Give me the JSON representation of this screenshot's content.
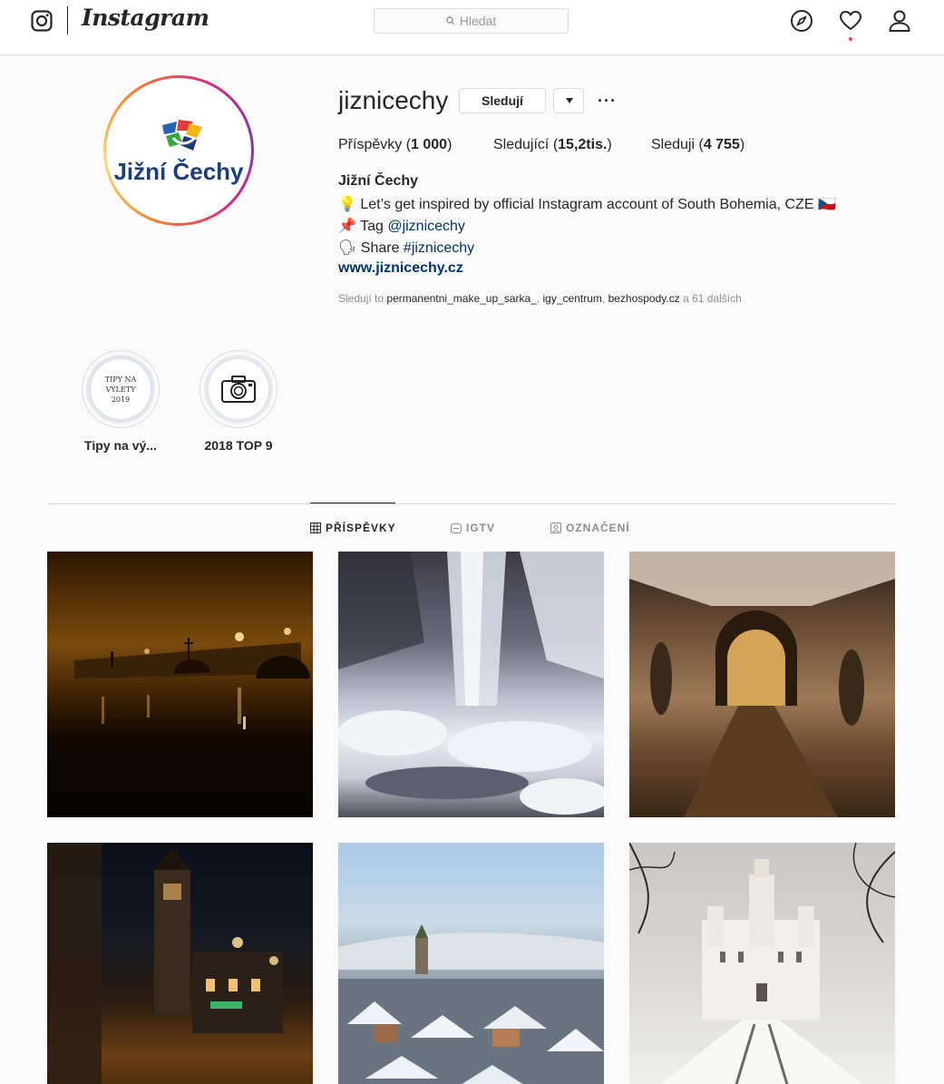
{
  "nav": {
    "wordmark": "Instagram",
    "search_placeholder": "Hledat",
    "icons": [
      "instagram-icon",
      "search-icon",
      "compass-icon",
      "heart-icon",
      "user-icon"
    ],
    "notification_color": "#ed4956"
  },
  "profile": {
    "avatar_text": "Jižní Čechy",
    "username": "jiznicechy",
    "follow_label": "Sledují",
    "more_label": "···",
    "stats": {
      "posts_label": "Příspěvky",
      "posts_value": "1 000",
      "followers_label": "Sledující",
      "followers_value": "15,2tis.",
      "following_label": "Sleduji",
      "following_value": "4 755"
    },
    "bio": {
      "name": "Jižní Čechy",
      "line1_emoji": "💡",
      "line1": "Let’s get inspired by official Instagram account of South Bohemia, CZE",
      "line1_flag": "🇨🇿",
      "line2_emoji": "📌",
      "line2_prefix": "Tag",
      "line2_link": "@jiznicechy",
      "line3_emoji": "🗣",
      "line3_prefix": "Share",
      "line3_link": "#jiznicechy",
      "url": "www.jiznicechy.cz"
    },
    "followed_by": {
      "prefix": "Sledují to",
      "user1": "permanentni_make_up_sarka_",
      "user2": "igy_centrum",
      "user3": "bezhospody.cz",
      "suffix": "a 61 dalších"
    }
  },
  "highlights": [
    {
      "label": "Tipy na vý...",
      "cover_text": "TIPY NA VÝLETY 2019"
    },
    {
      "label": "2018 TOP 9",
      "cover_icon": "camera-icon"
    }
  ],
  "tabs": [
    {
      "label": "PŘÍSPĚVKY",
      "icon": "grid-icon",
      "active": true
    },
    {
      "label": "IGTV",
      "icon": "igtv-icon",
      "active": false
    },
    {
      "label": "OZNAČENÍ",
      "icon": "tagged-icon",
      "active": false
    }
  ],
  "posts": [
    {
      "subject": "night-bridge"
    },
    {
      "subject": "frozen-waterfall"
    },
    {
      "subject": "castle-arch"
    },
    {
      "subject": "night-street-tower"
    },
    {
      "subject": "winter-town"
    },
    {
      "subject": "white-castle"
    }
  ]
}
